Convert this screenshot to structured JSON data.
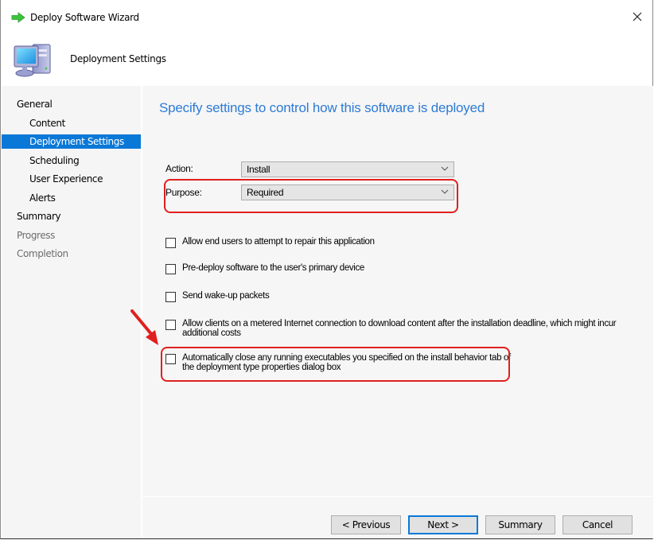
{
  "window": {
    "title": "Deploy Software Wizard",
    "title_icon": "green-arrow-icon",
    "close_icon": "close-icon"
  },
  "header": {
    "title": "Deployment Settings",
    "icon": "computer-icon"
  },
  "nav": {
    "items": [
      {
        "label": "General",
        "level": 0,
        "state": "normal"
      },
      {
        "label": "Content",
        "level": 1,
        "state": "normal"
      },
      {
        "label": "Deployment Settings",
        "level": 1,
        "state": "selected"
      },
      {
        "label": "Scheduling",
        "level": 1,
        "state": "normal"
      },
      {
        "label": "User Experience",
        "level": 1,
        "state": "normal"
      },
      {
        "label": "Alerts",
        "level": 1,
        "state": "normal"
      },
      {
        "label": "Summary",
        "level": 0,
        "state": "normal"
      },
      {
        "label": "Progress",
        "level": 0,
        "state": "disabled"
      },
      {
        "label": "Completion",
        "level": 0,
        "state": "disabled"
      }
    ]
  },
  "main": {
    "heading": "Specify settings to control how this software is deployed",
    "action": {
      "label": "Action:",
      "value": "Install"
    },
    "purpose": {
      "label": "Purpose:",
      "value": "Required"
    },
    "options": [
      {
        "label": "Allow end users to attempt to repair this application",
        "checked": false
      },
      {
        "label": "Pre-deploy software to the user's primary device",
        "checked": false
      },
      {
        "label": "Send wake-up packets",
        "checked": false
      },
      {
        "label": "Allow clients on a metered Internet connection to download content after the installation deadline, which might incur additional costs",
        "checked": false
      },
      {
        "label": "Automatically close any running executables you specified on the install behavior tab of the deployment type properties dialog box",
        "checked": false
      }
    ],
    "annotation_color": "#e0201f"
  },
  "buttons": {
    "previous": "< Previous",
    "next": "Next >",
    "summary": "Summary",
    "cancel": "Cancel"
  },
  "colors": {
    "accent": "#0a78d7",
    "heading": "#2d7bd6"
  }
}
